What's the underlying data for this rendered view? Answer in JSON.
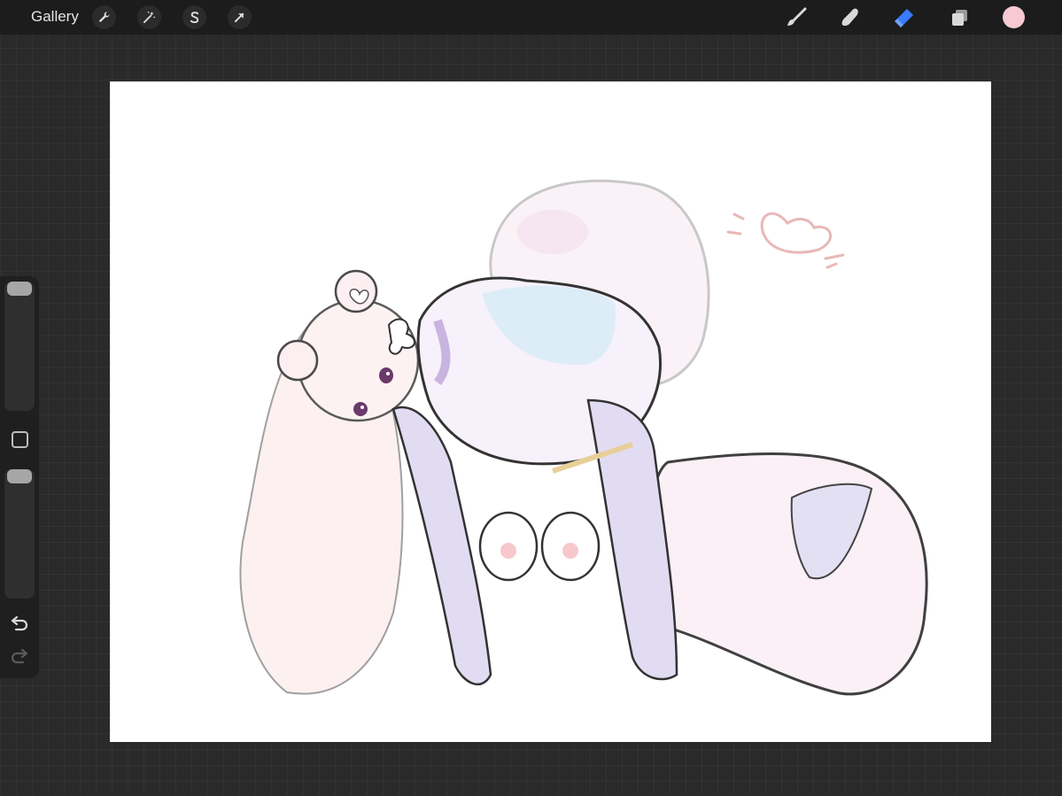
{
  "topbar": {
    "gallery_label": "Gallery",
    "left_tools": [
      {
        "name": "actions",
        "icon": "wrench-icon"
      },
      {
        "name": "adjustments",
        "icon": "magic-wand-icon"
      },
      {
        "name": "selection",
        "icon": "selection-s-icon"
      },
      {
        "name": "transform",
        "icon": "arrow-cursor-icon"
      }
    ],
    "right_tools": [
      {
        "name": "brush",
        "icon": "paintbrush-icon",
        "active": false
      },
      {
        "name": "smudge",
        "icon": "smudge-finger-icon",
        "active": false
      },
      {
        "name": "eraser",
        "icon": "eraser-icon",
        "active": true
      },
      {
        "name": "layers",
        "icon": "layers-icon",
        "active": false
      }
    ],
    "current_color": "#f7c9d2"
  },
  "sidebar": {
    "brush_size_level": 0.0,
    "opacity_level": 0.0,
    "modify_icon": "square-icon",
    "undo_icon": "undo-icon",
    "redo_icon": "redo-icon"
  },
  "colors": {
    "active_tool": "#3a7bff",
    "inactive_tool": "#d9d9d9",
    "canvas_bg": "#ffffff"
  }
}
